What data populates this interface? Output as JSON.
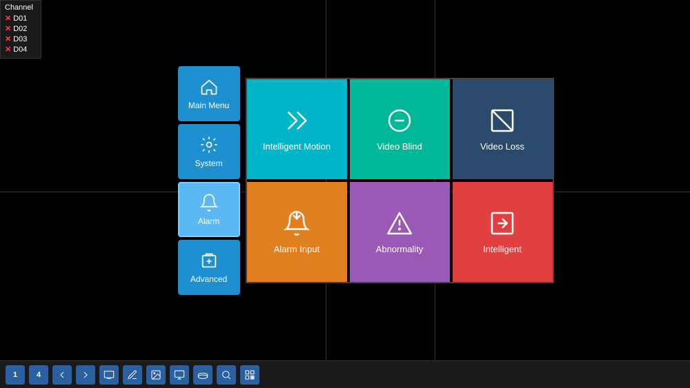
{
  "channel": {
    "title": "Channel",
    "items": [
      {
        "id": "D01",
        "status": "x"
      },
      {
        "id": "D02",
        "status": "x"
      },
      {
        "id": "D03",
        "status": "x"
      },
      {
        "id": "D04",
        "status": "x"
      }
    ]
  },
  "leftMenu": {
    "items": [
      {
        "id": "main-menu",
        "label": "Main Menu",
        "icon": "home"
      },
      {
        "id": "system",
        "label": "System",
        "icon": "gear"
      },
      {
        "id": "alarm",
        "label": "Alarm",
        "icon": "bell",
        "active": true
      },
      {
        "id": "advanced",
        "label": "Advanced",
        "icon": "box"
      }
    ]
  },
  "grid": {
    "items": [
      {
        "id": "intelligent-motion",
        "label": "Intelligent Motion",
        "icon": "motion",
        "color": "cyan"
      },
      {
        "id": "video-blind",
        "label": "Video Blind",
        "icon": "minus-circle",
        "color": "teal"
      },
      {
        "id": "video-loss",
        "label": "Video Loss",
        "icon": "slash-box",
        "color": "slate"
      },
      {
        "id": "alarm-input",
        "label": "Alarm Input",
        "icon": "bell-down",
        "color": "orange"
      },
      {
        "id": "abnormality",
        "label": "Abnormality",
        "icon": "warning",
        "color": "purple"
      },
      {
        "id": "intelligent",
        "label": "Intelligent",
        "icon": "arrow-right-box",
        "color": "red"
      }
    ]
  },
  "taskbar": {
    "buttons": [
      {
        "id": "num1",
        "label": "1",
        "type": "num"
      },
      {
        "id": "num4",
        "label": "4",
        "type": "num"
      },
      {
        "id": "back",
        "label": "←",
        "type": "icon"
      },
      {
        "id": "forward",
        "label": "→",
        "type": "icon"
      },
      {
        "id": "screen",
        "label": "⬜",
        "type": "icon"
      },
      {
        "id": "pen",
        "label": "✏",
        "type": "icon"
      },
      {
        "id": "image",
        "label": "🖼",
        "type": "icon"
      },
      {
        "id": "monitor",
        "label": "🖥",
        "type": "icon"
      },
      {
        "id": "hdd",
        "label": "💾",
        "type": "icon"
      },
      {
        "id": "search",
        "label": "🔍",
        "type": "icon"
      },
      {
        "id": "qr",
        "label": "⊞",
        "type": "icon"
      }
    ]
  }
}
